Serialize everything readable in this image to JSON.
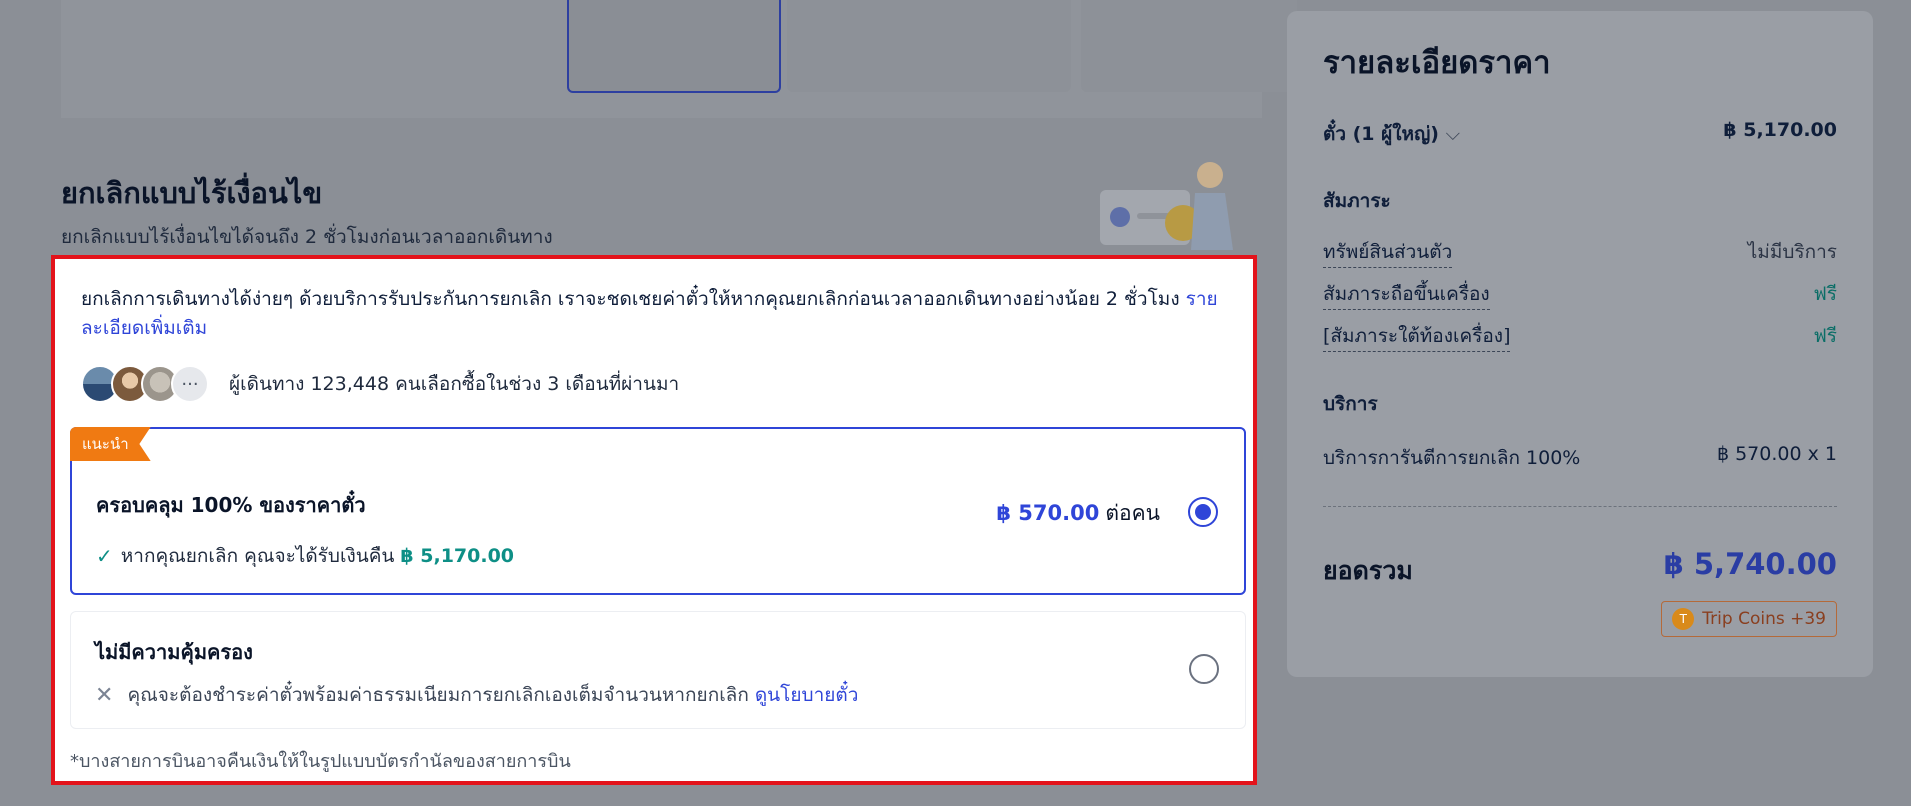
{
  "cancel_section": {
    "title": "ยกเลิกแบบไร้เงื่อนไข",
    "subtitle": "ยกเลิกแบบไร้เงื่อนไขได้จนถึง 2 ชั่วโมงก่อนเวลาออกเดินทาง"
  },
  "modal": {
    "intro_text": "ยกเลิกการเดินทางได้ง่ายๆ ด้วยบริการรับประกันการยกเลิก เราจะชดเชยค่าตั๋วให้หากคุณยกเลิกก่อนเวลาออกเดินทางอย่างน้อย 2 ชั่วโมง",
    "intro_link": "รายละเอียดเพิ่มเติม",
    "more_avatars": "···",
    "travellers_text": "ผู้เดินทาง 123,448 คนเลือกซื้อในช่วง 3 เดือนที่ผ่านมา",
    "recommended": {
      "badge": "แนะนำ",
      "title": "ครอบคลุม 100% ของราคาตั๋ว",
      "price": "฿ 570.00",
      "price_unit": "ต่อคน",
      "benefit_icon": "check-icon",
      "benefit_text": "หากคุณยกเลิก คุณจะได้รับเงินคืน",
      "benefit_amount": "฿ 5,170.00",
      "selected": true
    },
    "no_cover": {
      "title": "ไม่มีความคุ้มครอง",
      "icon": "x-icon",
      "text": "คุณจะต้องชำระค่าตั๋วพร้อมค่าธรรมเนียมการยกเลิกเองเต็มจำนวนหากยกเลิก",
      "link": "ดูนโยบายตั๋ว",
      "selected": false
    },
    "footnote": "*บางสายการบินอาจคืนเงินให้ในรูปแบบบัตรกำนัลของสายการบิน"
  },
  "price_panel": {
    "title": "รายละเอียดราคา",
    "ticket_label": "ตั๋ว (1 ผู้ใหญ่)",
    "ticket_price": "฿ 5,170.00",
    "baggage_heading": "สัมภาระ",
    "baggage": [
      {
        "label": "ทรัพย์สินส่วนตัว",
        "value": "ไม่มีบริการ"
      },
      {
        "label": "สัมภาระถือขึ้นเครื่อง",
        "value": "ฟรี"
      },
      {
        "label": "[สัมภาระใต้ท้องเครื่อง]",
        "value": "ฟรี"
      }
    ],
    "services_heading": "บริการ",
    "service_label": "บริการการันตีการยกเลิก 100%",
    "service_value": "฿ 570.00 x 1",
    "total_label": "ยอดรวม",
    "total_amount": "฿ 5,740.00",
    "trip_coins": "Trip Coins +39"
  },
  "colors": {
    "accent": "#2f45d8",
    "highlight_border": "#e3131b",
    "badge": "#f07a12",
    "success": "#0e8f86"
  }
}
